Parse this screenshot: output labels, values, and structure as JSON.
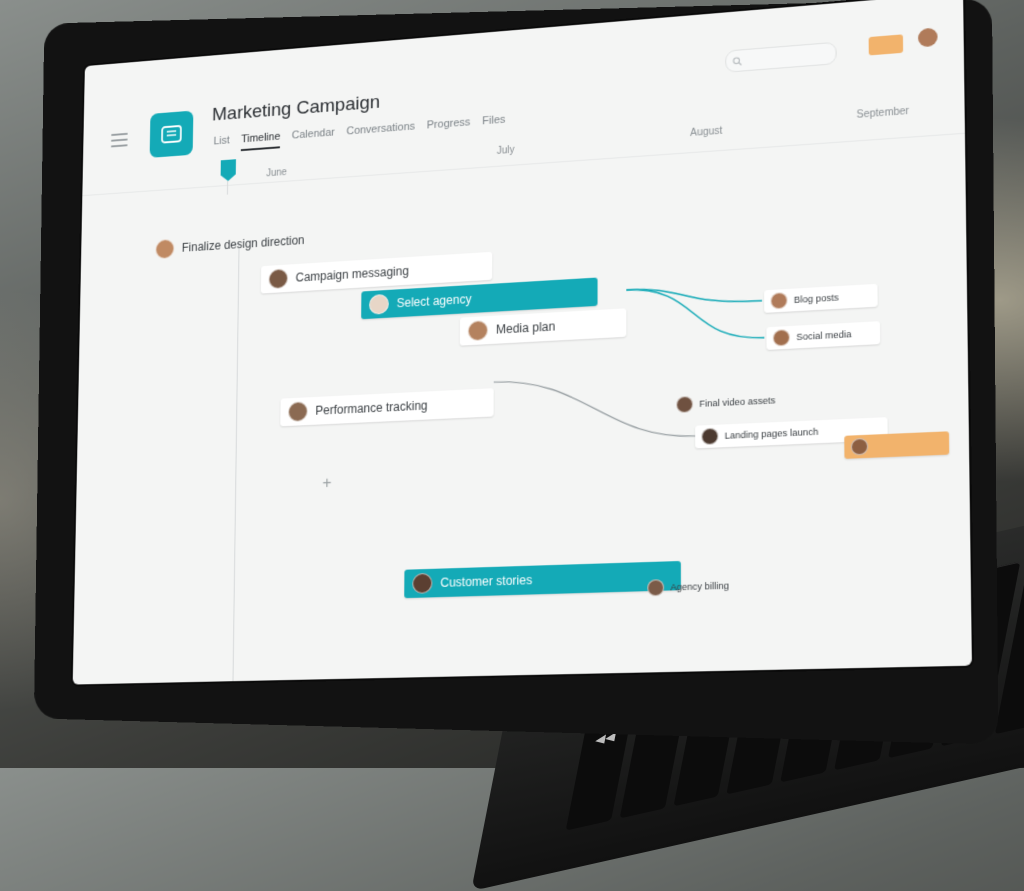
{
  "project": {
    "title": "Marketing Campaign",
    "icon": "list-icon",
    "accent": "#14AAB7"
  },
  "tabs": [
    {
      "label": "List",
      "active": false
    },
    {
      "label": "Timeline",
      "active": true
    },
    {
      "label": "Calendar",
      "active": false
    },
    {
      "label": "Conversations",
      "active": false
    },
    {
      "label": "Progress",
      "active": false
    },
    {
      "label": "Files",
      "active": false
    }
  ],
  "header": {
    "upgrade_color": "#F2B36C"
  },
  "months": [
    {
      "label": "June"
    },
    {
      "label": "July"
    },
    {
      "label": "August"
    },
    {
      "label": "September"
    }
  ],
  "tasks": [
    {
      "name": "Finalize design direction",
      "color": "white",
      "avatar_color": "#c08a63"
    },
    {
      "name": "Campaign messaging",
      "color": "white",
      "avatar_color": "#7a5a45"
    },
    {
      "name": "Select agency",
      "color": "teal",
      "avatar_color": "#e7d6c7"
    },
    {
      "name": "Media plan",
      "color": "white",
      "avatar_color": "#b4825f"
    },
    {
      "name": "Performance tracking",
      "color": "white",
      "avatar_color": "#8b6a52"
    },
    {
      "name": "Blog posts",
      "color": "white",
      "avatar_color": "#b07b5a"
    },
    {
      "name": "Social media",
      "color": "white",
      "avatar_color": "#a26f4e"
    },
    {
      "name": "Final video assets",
      "color": "white",
      "avatar_color": "#6f5140"
    },
    {
      "name": "Landing pages launch",
      "color": "white",
      "avatar_color": "#4c3a30"
    },
    {
      "name": "Customer stories",
      "color": "teal",
      "avatar_color": "#5b3f31"
    },
    {
      "name": "Agency billing",
      "color": "white",
      "avatar_color": "#7b5b48"
    }
  ],
  "touchbar": {
    "rewind": "◀◀",
    "play": "▶",
    "forward": "▶▶"
  },
  "colors": {
    "teal": "#14AAB7",
    "orange": "#F2B36C",
    "link_line": "#14AAB7"
  }
}
